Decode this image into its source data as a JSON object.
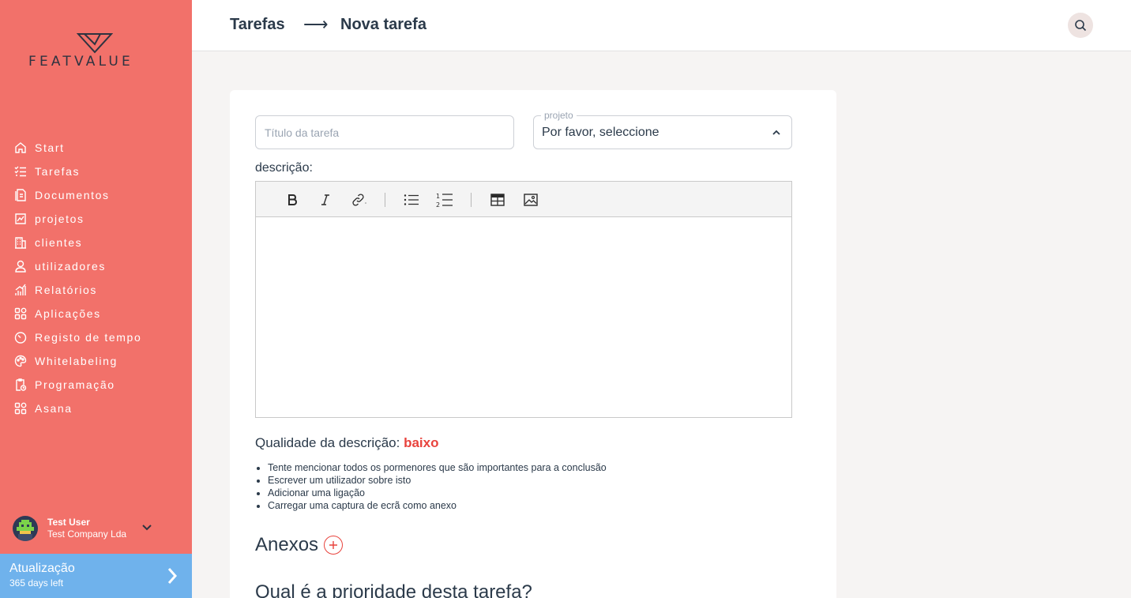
{
  "sidebar": {
    "logo_text": "FEATVALUE",
    "items": [
      {
        "label": "Start",
        "icon": "home-icon"
      },
      {
        "label": "Tarefas",
        "icon": "tasks-icon"
      },
      {
        "label": "Documentos",
        "icon": "documents-icon"
      },
      {
        "label": "projetos",
        "icon": "projects-icon"
      },
      {
        "label": "clientes",
        "icon": "clients-icon"
      },
      {
        "label": "utilizadores",
        "icon": "user-icon"
      },
      {
        "label": "Relatórios",
        "icon": "reports-icon"
      },
      {
        "label": "Aplicações",
        "icon": "apps-icon"
      },
      {
        "label": "Registo de tempo",
        "icon": "timer-icon"
      },
      {
        "label": "Whitelabeling",
        "icon": "palette-icon"
      },
      {
        "label": "Programação",
        "icon": "schedule-icon"
      },
      {
        "label": "Asana",
        "icon": "apps-icon"
      }
    ],
    "user": {
      "name": "Test User",
      "company": "Test Company Lda"
    },
    "upgrade": {
      "title": "Atualização",
      "subtitle": "365 days left"
    }
  },
  "header": {
    "crumb_parent": "Tarefas",
    "crumb_arrow": "⟶",
    "crumb_current": "Nova tarefa"
  },
  "form": {
    "title_placeholder": "Título da tarefa",
    "project_label": "projeto",
    "project_value": "Por favor, seleccione",
    "description_label": "descrição:",
    "quality_label": "Qualidade da descrição:",
    "quality_value": "baixo",
    "tips": [
      "Tente mencionar todos os pormenores que são importantes para a conclusão",
      "Escrever um utilizador sobre isto",
      "Adicionar uma ligação",
      "Carregar uma captura de ecrã como anexo"
    ],
    "attachments_label": "Anexos",
    "priority_label": "Qual é a prioridade desta tarefa?"
  },
  "colors": {
    "sidebar": "#f2716a",
    "upgrade": "#6fb2ec",
    "accent_red": "#e8433d",
    "text_dark": "#2b3a4a"
  }
}
